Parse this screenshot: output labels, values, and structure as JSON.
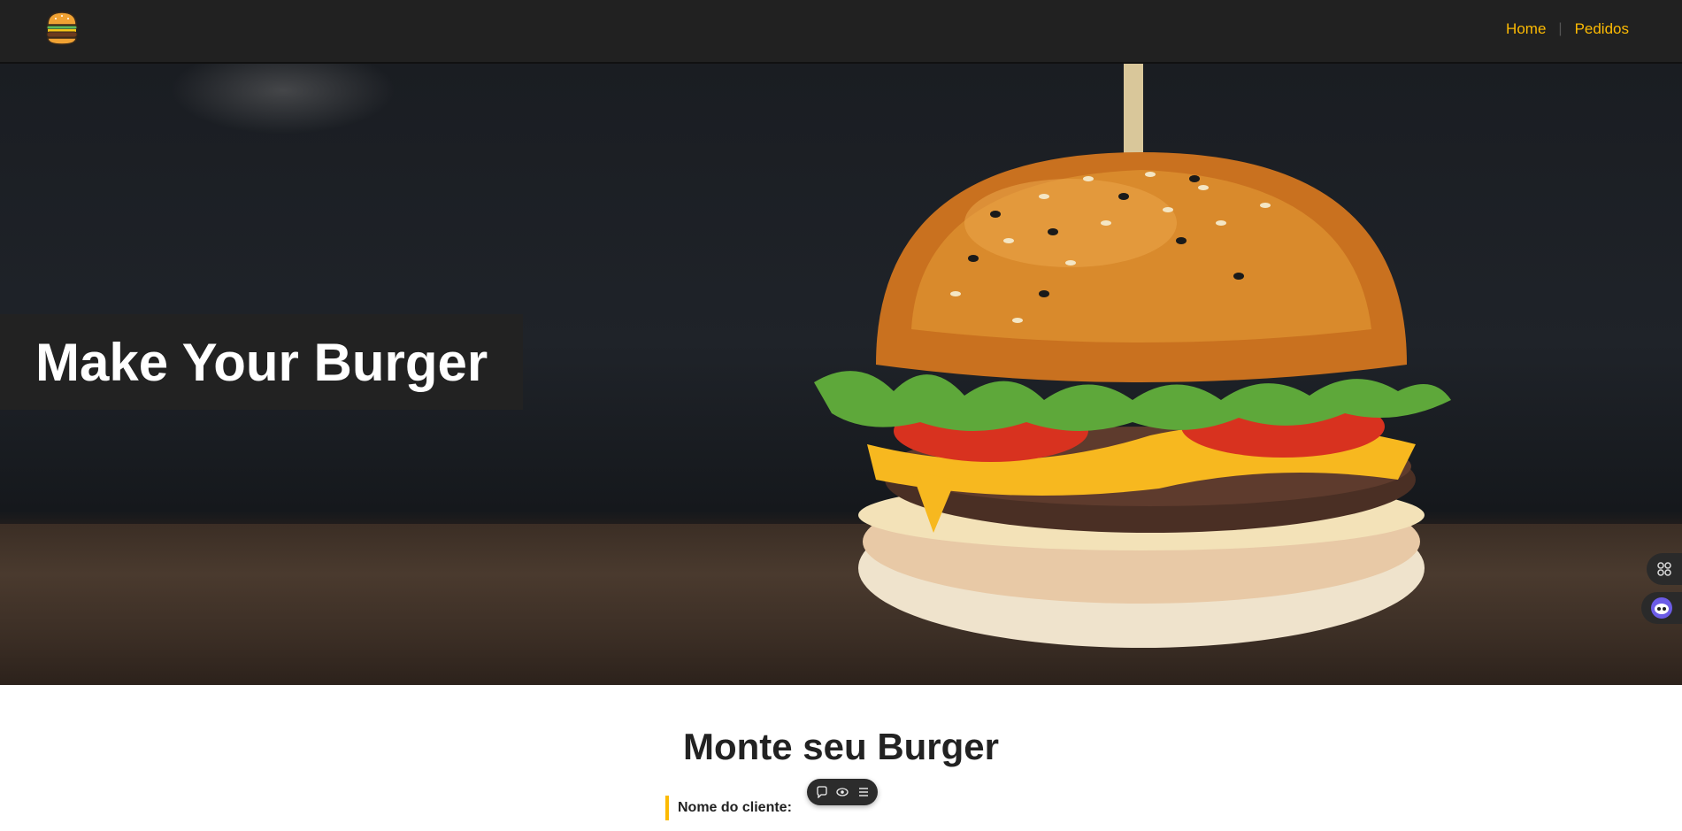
{
  "nav": {
    "logo_icon": "burger-icon",
    "links": [
      {
        "label": "Home"
      },
      {
        "label": "Pedidos"
      }
    ],
    "accent_color": "#fcba03",
    "background_color": "#212121"
  },
  "hero": {
    "title": "Make Your Burger",
    "image_icon": "burger-photo"
  },
  "form": {
    "heading": "Monte seu Burger",
    "fields": [
      {
        "label": "Nome do cliente:"
      }
    ]
  },
  "side_widgets": [
    {
      "icon": "grid-icon"
    },
    {
      "icon": "bot-icon"
    }
  ],
  "floating_toolbar": {
    "icons": [
      "comment-icon",
      "eye-icon",
      "menu-icon"
    ]
  }
}
